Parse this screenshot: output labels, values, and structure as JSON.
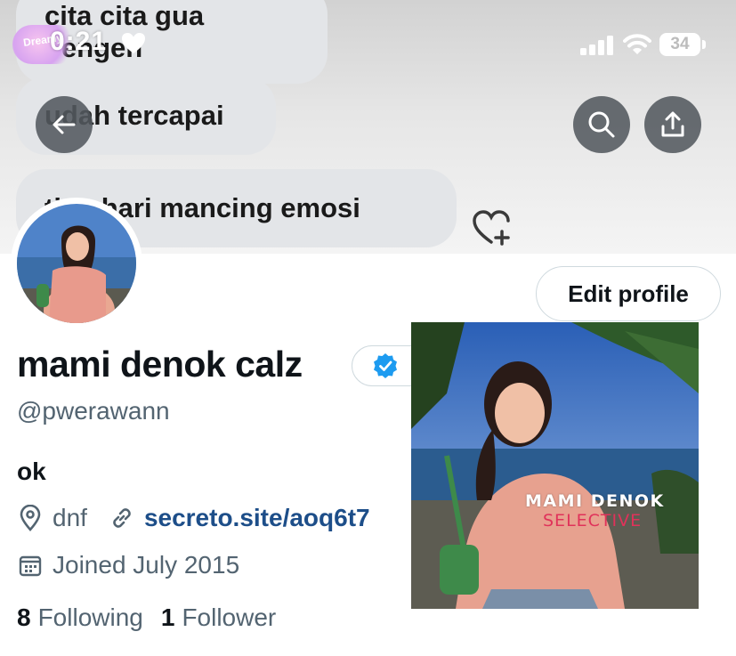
{
  "status_bar": {
    "time": "0:21",
    "battery": "34",
    "sticker_text": "Dreamy"
  },
  "banner": {
    "bubbles": [
      "cita cita gua pengen",
      "udah tercapai",
      "tiap hari mancing emosi"
    ]
  },
  "header": {
    "back_icon": "arrow-left-icon",
    "search_icon": "search-icon",
    "share_icon": "share-icon"
  },
  "profile": {
    "display_name": "mami denok calz",
    "handle": "@pwerawann",
    "bio": "ok",
    "location": "dnf",
    "link": "secreto.site/aoq6t7",
    "joined": "Joined July 2015",
    "edit_button": "Edit profile",
    "following_count": "8",
    "following_label": "Following",
    "followers_count": "1",
    "followers_label": "Follower"
  },
  "overlay_image": {
    "line1": "MAMI DENOK",
    "line2": "SELECTIVE"
  },
  "colors": {
    "link": "#1d4e89",
    "verified": "#1d9bf0",
    "muted": "#536471"
  }
}
